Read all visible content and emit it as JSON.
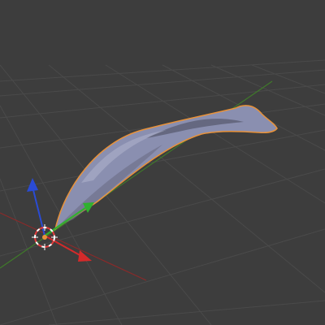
{
  "viewport": {
    "background_color": "#3d3d3d",
    "grid_color": "#4a4a4a",
    "x_axis_color": "#8a2a2a",
    "y_axis_color": "#3f7a2a"
  },
  "selected_object": {
    "outline_color": "#e8923a",
    "fill_color": "#8a8fb0",
    "shade_color": "#6a6d86",
    "highlight_color": "#b3b7d0"
  },
  "gizmo": {
    "icons": [
      "3d-cursor-icon",
      "z-axis-arrow-icon",
      "x-axis-arrow-icon",
      "y-axis-arrow-icon"
    ],
    "x_color": "#d42a2a",
    "y_color": "#2fb12f",
    "z_color": "#2a4bd4",
    "cursor_color_a": "#e23a3a",
    "cursor_color_b": "#ffffff"
  }
}
